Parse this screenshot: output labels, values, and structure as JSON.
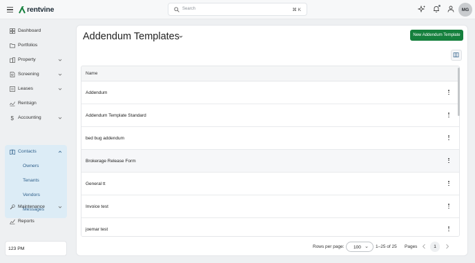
{
  "header": {
    "logo_text": "rentvine",
    "search_placeholder": "Search",
    "search_shortcut": "⌘ K",
    "avatar_initials": "MG"
  },
  "sidebar": {
    "items": [
      {
        "label": "Dashboard",
        "icon": "dashboard-icon"
      },
      {
        "label": "Portfolios",
        "icon": "folder-icon"
      },
      {
        "label": "Property",
        "icon": "building-icon"
      },
      {
        "label": "Screening",
        "icon": "document-search-icon"
      },
      {
        "label": "Leases",
        "icon": "lease-icon"
      },
      {
        "label": "Rentsign",
        "icon": "signature-icon"
      },
      {
        "label": "Accounting",
        "icon": "dollar-icon"
      },
      {
        "label": "Contacts",
        "icon": "contact-book-icon"
      },
      {
        "label": "Maintenance",
        "icon": "wrench-icon"
      },
      {
        "label": "Reports",
        "icon": "chart-icon"
      }
    ],
    "contacts_sub": [
      "Owners",
      "Tenants",
      "Vendors",
      "Messages"
    ],
    "time_label": "123 PM"
  },
  "main": {
    "title": "Addendum Templates",
    "new_button": "New Addendum Template",
    "column_header": "Name",
    "rows": [
      "Addendum",
      "Addendum Template Standard",
      "bed bug addendum",
      "Brokerage Release Form",
      "General tt",
      "Invoice test",
      "joemar test"
    ],
    "pagination": {
      "rows_per_page_label": "Rows per page:",
      "rows_per_page_value": "100",
      "range": "1–25 of 25",
      "pages_label": "Pages",
      "current_page": "1"
    }
  },
  "colors": {
    "accent_green": "#15803d",
    "sidebar_active_bg": "#dcecf6",
    "sidebar_active_text": "#2e5f8a"
  }
}
